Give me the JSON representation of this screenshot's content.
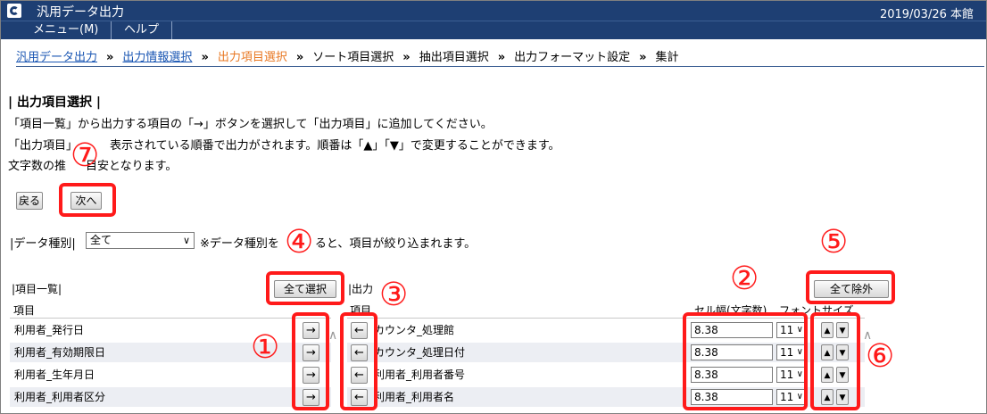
{
  "window": {
    "title": "汎用データ出力",
    "date_location": "2019/03/26 本館"
  },
  "menu": {
    "items": [
      "メニュー(M)",
      "ヘルプ"
    ]
  },
  "breadcrumb": {
    "items": [
      "汎用データ出力",
      "出力情報選択",
      "出力項目選択",
      "ソート項目選択",
      "抽出項目選択",
      "出力フォーマット設定",
      "集計"
    ],
    "separator": "»"
  },
  "section": {
    "title": "| 出力項目選択 |",
    "desc1": "「項目一覧」から出力する項目の「→」ボタンを選択して「出力項目」に追加してください。",
    "desc2a": "「出力項目」",
    "desc2b": "表示されている順番で出力がされます。順番は「▲」「▼」で変更することができます。",
    "desc3a": "文字数の推",
    "desc3b": "目安となります。"
  },
  "nav": {
    "back": "戻る",
    "next": "次へ"
  },
  "filter": {
    "label": "|データ種別|",
    "selected": "全て",
    "note_a": "※データ種別を",
    "note_b": "ると、項目が絞り込まれます。"
  },
  "source_list": {
    "label": "|項目一覧|",
    "column": "項目",
    "select_all": "全て選択",
    "items": [
      "利用者_発行日",
      "利用者_有効期限日",
      "利用者_生年月日",
      "利用者_利用者区分"
    ]
  },
  "output_list": {
    "label": "|出力",
    "column": "項目",
    "col_width": "セル幅(文字数)",
    "col_font": "フォントサイズ",
    "remove_all": "全て除外",
    "rows": [
      {
        "name": "カウンタ_処理館",
        "width": "8.38",
        "font": "11"
      },
      {
        "name": "カウンタ_処理日付",
        "width": "8.38",
        "font": "11"
      },
      {
        "name": "利用者_利用者番号",
        "width": "8.38",
        "font": "11"
      },
      {
        "name": "利用者_利用者名",
        "width": "8.38",
        "font": "11"
      }
    ]
  },
  "glyphs": {
    "add": "→",
    "remove": "←",
    "up": "▲",
    "down": "▼",
    "chevron": "∨",
    "scroll_up": "∧"
  },
  "annotations": [
    "①",
    "②",
    "③",
    "④",
    "⑤",
    "⑥",
    "⑦"
  ],
  "colors": {
    "titlebar": "#1e3f73",
    "highlight": "#ff1a1a",
    "link": "#1a56b3",
    "current_step": "#e87722"
  }
}
